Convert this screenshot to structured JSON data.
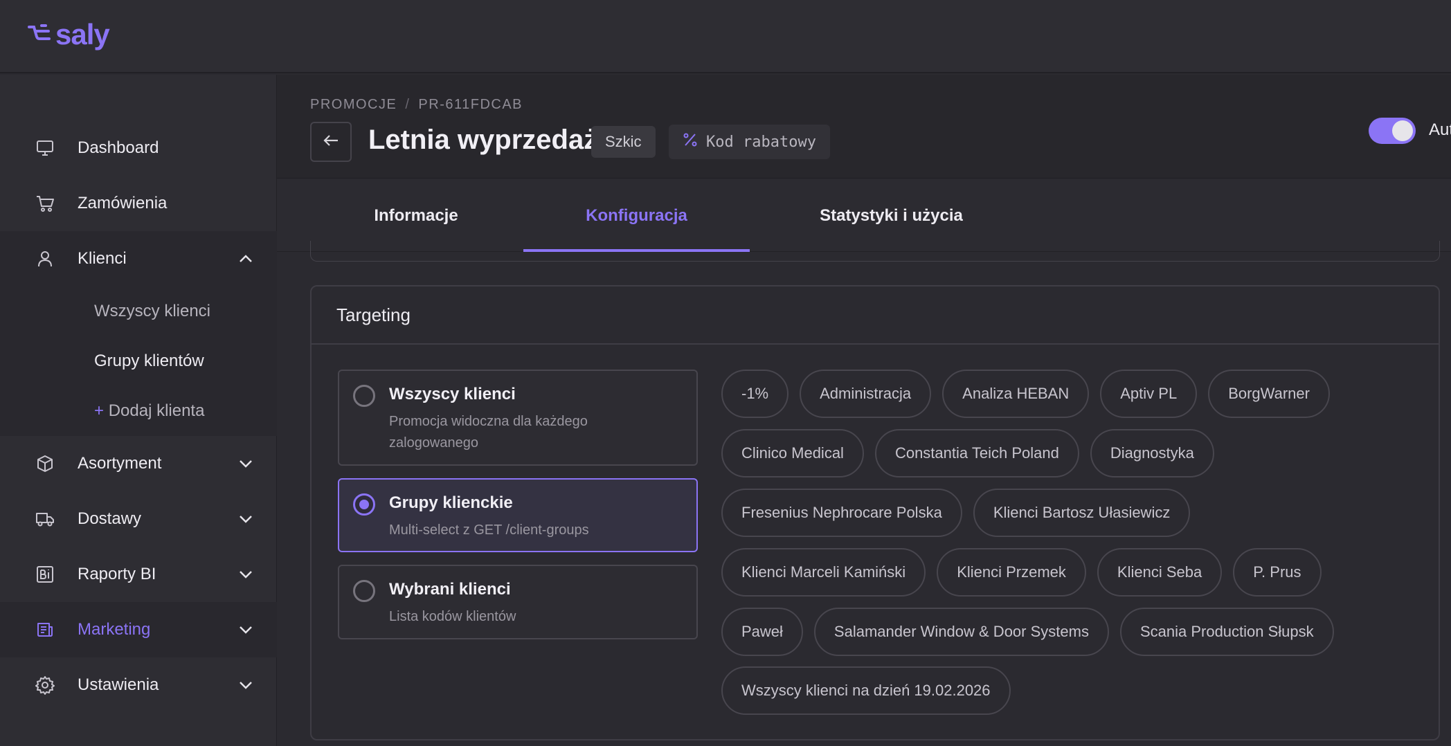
{
  "app": {
    "logo": "saly"
  },
  "sidebar": {
    "items": [
      {
        "label": "Dashboard",
        "icon": "monitor-icon"
      },
      {
        "label": "Zamówienia",
        "icon": "cart-icon"
      },
      {
        "label": "Klienci",
        "icon": "user-icon",
        "expanded": true
      },
      {
        "label": "Asortyment",
        "icon": "box-icon"
      },
      {
        "label": "Dostawy",
        "icon": "truck-icon"
      },
      {
        "label": "Raporty BI",
        "icon": "bi-report-icon"
      },
      {
        "label": "Marketing",
        "icon": "newspaper-icon",
        "active": true
      },
      {
        "label": "Ustawienia",
        "icon": "gear-icon"
      }
    ],
    "sub_items": [
      {
        "label": "Wszyscy klienci"
      },
      {
        "label": "Grupy klientów",
        "active": true
      },
      {
        "plus": "+",
        "label": "Dodaj klienta"
      }
    ]
  },
  "header": {
    "breadcrumb": [
      "PROMOCJE",
      "PR-611FDCAB"
    ],
    "breadcrumb_sep": "/",
    "title": "Letnia wyprzedaż",
    "status_badge": "Szkic",
    "type_badge": "Kod rabatowy",
    "toggle_label": "Aut",
    "toggle_on": true
  },
  "tabs": [
    {
      "label": "Informacje"
    },
    {
      "label": "Konfiguracja",
      "active": true
    },
    {
      "label": "Statystyki i użycia"
    }
  ],
  "targeting": {
    "title": "Targeting",
    "options": [
      {
        "title": "Wszyscy klienci",
        "desc": "Promocja widoczna dla każdego zalogowanego",
        "selected": false
      },
      {
        "title": "Grupy klienckie",
        "desc": "Multi-select z GET /client-groups",
        "selected": true
      },
      {
        "title": "Wybrani klienci",
        "desc": "Lista kodów klientów",
        "selected": false
      }
    ],
    "groups": [
      [
        "-1%",
        "Administracja",
        "Analiza HEBAN",
        "Aptiv PL",
        "BorgWarner"
      ],
      [
        "Clinico Medical",
        "Constantia Teich Poland",
        "Diagnostyka"
      ],
      [
        "Fresenius Nephrocare Polska",
        "Klienci Bartosz Ułasiewicz"
      ],
      [
        "Klienci Marceli Kamiński",
        "Klienci Przemek",
        "Klienci Seba",
        "P. Prus"
      ],
      [
        "Paweł",
        "Salamander Window & Door Systems",
        "Scania Production Słupsk"
      ],
      [
        "Wszyscy klienci na dzień 19.02.2026"
      ]
    ]
  },
  "colors": {
    "accent": "#8b74f5",
    "background": "#2b2a30"
  }
}
